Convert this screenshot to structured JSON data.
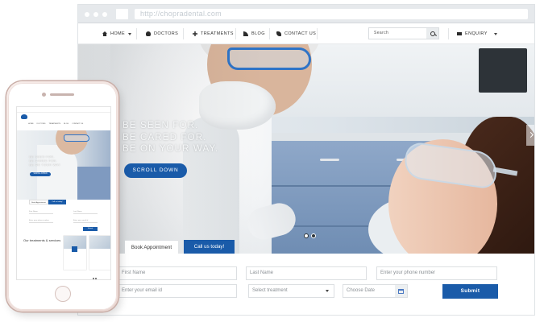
{
  "browser": {
    "url": "http://chopradental.com"
  },
  "nav": {
    "items": [
      {
        "label": "HOME",
        "icon": "home-icon"
      },
      {
        "label": "DOCTORS",
        "icon": "doctor-icon"
      },
      {
        "label": "TREATMENTS",
        "icon": "plus-icon"
      },
      {
        "label": "BLOG",
        "icon": "rss-icon"
      },
      {
        "label": "CONTACT US",
        "icon": "phone-icon"
      }
    ],
    "search_placeholder": "Search",
    "enquiry_label": "ENQUIRY"
  },
  "hero": {
    "lines": [
      "BE SEEN FOR.",
      "BE CARED FOR.",
      "BE ON YOUR WAY."
    ],
    "scroll_label": "SCROLL DOWN"
  },
  "tabs": {
    "book": "Book Appointment",
    "call": "Call us today!"
  },
  "form": {
    "first_name": "First Name",
    "last_name": "Last Name",
    "phone": "Enter your phone number",
    "email": "Enter your email id",
    "treatment": "Select treatment",
    "date": "Choose Date",
    "submit": "Submit"
  },
  "mobile": {
    "treatments_heading": "Our treatments & services"
  },
  "colors": {
    "brand_blue": "#1a5ba9",
    "chrome": "#e6e9ec"
  }
}
